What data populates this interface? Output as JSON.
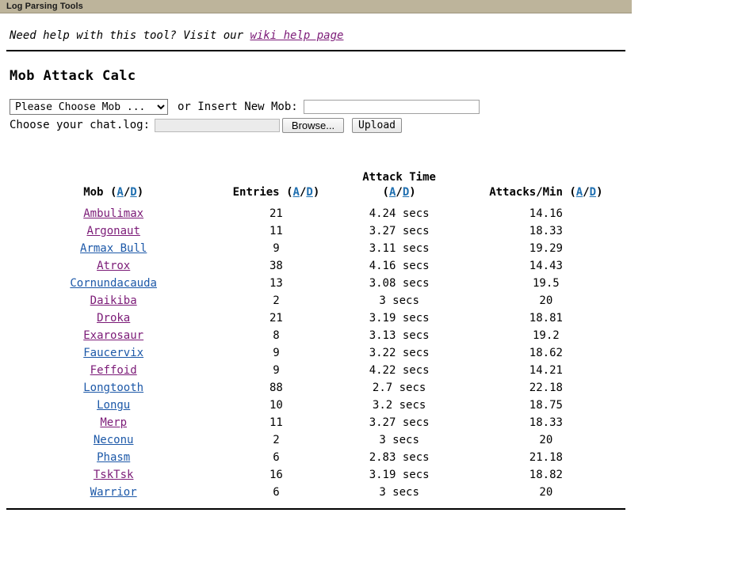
{
  "window": {
    "title": "Log Parsing Tools",
    "titlebar_color": "#bdb49b"
  },
  "help": {
    "prefix": "Need help with this tool? Visit our ",
    "link_label": "wiki help page"
  },
  "page_title": "Mob Attack Calc",
  "form": {
    "mob_select_value": "Please Choose Mob ...",
    "mob_select_options": [
      "Please Choose Mob ..."
    ],
    "or_label": "or Insert New Mob:",
    "new_mob_value": "",
    "new_mob_placeholder": "",
    "chatlog_label": "Choose your chat.log:",
    "file_value": "",
    "browse_label": "Browse...",
    "upload_label": "Upload"
  },
  "table": {
    "headers": {
      "mob": "Mob",
      "entries": "Entries",
      "attack_time_line1": "Attack Time",
      "attacks_min": "Attacks/Min"
    },
    "sort": {
      "open": "(",
      "asc": "A",
      "sep": "/",
      "desc": "D",
      "close": ")"
    },
    "rows": [
      {
        "mob": "Ambulimax",
        "link_state": "visited",
        "entries": "21",
        "attack_time": "4.24 secs",
        "attacks_min": "14.16"
      },
      {
        "mob": "Argonaut",
        "link_state": "visited",
        "entries": "11",
        "attack_time": "3.27 secs",
        "attacks_min": "18.33"
      },
      {
        "mob": "Armax Bull",
        "link_state": "unvisited",
        "entries": "9",
        "attack_time": "3.11 secs",
        "attacks_min": "19.29"
      },
      {
        "mob": "Atrox",
        "link_state": "visited",
        "entries": "38",
        "attack_time": "4.16 secs",
        "attacks_min": "14.43"
      },
      {
        "mob": "Cornundacauda",
        "link_state": "unvisited",
        "entries": "13",
        "attack_time": "3.08 secs",
        "attacks_min": "19.5"
      },
      {
        "mob": "Daikiba",
        "link_state": "visited",
        "entries": "2",
        "attack_time": "3 secs",
        "attacks_min": "20"
      },
      {
        "mob": "Droka",
        "link_state": "visited",
        "entries": "21",
        "attack_time": "3.19 secs",
        "attacks_min": "18.81"
      },
      {
        "mob": "Exarosaur",
        "link_state": "visited",
        "entries": "8",
        "attack_time": "3.13 secs",
        "attacks_min": "19.2"
      },
      {
        "mob": "Faucervix",
        "link_state": "unvisited",
        "entries": "9",
        "attack_time": "3.22 secs",
        "attacks_min": "18.62"
      },
      {
        "mob": "Feffoid",
        "link_state": "visited",
        "entries": "9",
        "attack_time": "4.22 secs",
        "attacks_min": "14.21"
      },
      {
        "mob": "Longtooth",
        "link_state": "unvisited",
        "entries": "88",
        "attack_time": "2.7 secs",
        "attacks_min": "22.18"
      },
      {
        "mob": "Longu",
        "link_state": "unvisited",
        "entries": "10",
        "attack_time": "3.2 secs",
        "attacks_min": "18.75"
      },
      {
        "mob": "Merp",
        "link_state": "visited",
        "entries": "11",
        "attack_time": "3.27 secs",
        "attacks_min": "18.33"
      },
      {
        "mob": "Neconu",
        "link_state": "unvisited",
        "entries": "2",
        "attack_time": "3 secs",
        "attacks_min": "20"
      },
      {
        "mob": "Phasm",
        "link_state": "unvisited",
        "entries": "6",
        "attack_time": "2.83 secs",
        "attacks_min": "21.18"
      },
      {
        "mob": "TskTsk",
        "link_state": "visited",
        "entries": "16",
        "attack_time": "3.19 secs",
        "attacks_min": "18.82"
      },
      {
        "mob": "Warrior",
        "link_state": "unvisited",
        "entries": "6",
        "attack_time": "3 secs",
        "attacks_min": "20"
      }
    ]
  }
}
